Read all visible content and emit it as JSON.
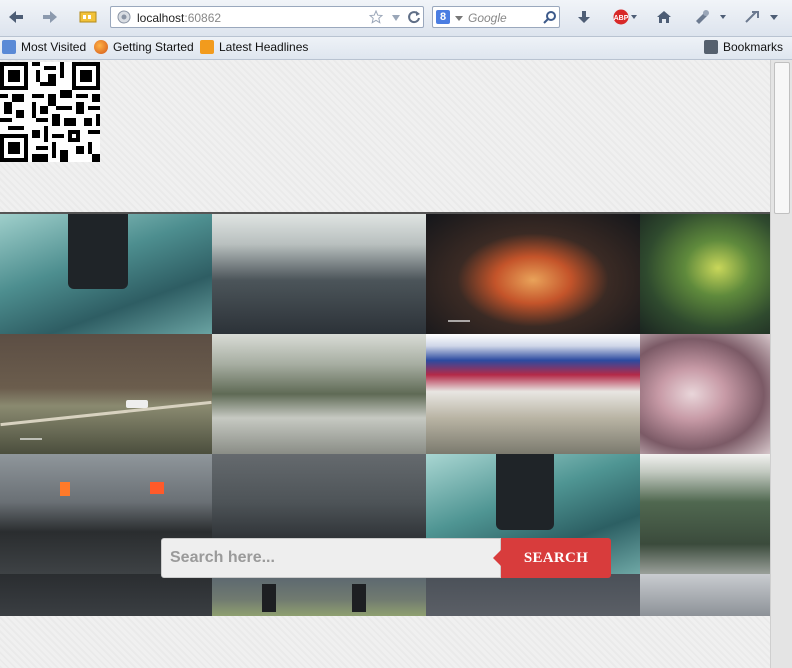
{
  "browser": {
    "url_host": "localhost",
    "url_port": ":60862",
    "search_placeholder": "Google",
    "search_engine_badge": "8",
    "icons": [
      "back-icon",
      "forward-icon",
      "feed-icon",
      "globe-icon",
      "star-icon",
      "reload-icon",
      "download-icon",
      "adblock-icon",
      "home-icon",
      "addon-icon",
      "menu-icon"
    ]
  },
  "bookmarks": {
    "most_visited": "Most Visited",
    "getting_started": "Getting Started",
    "latest_headlines": "Latest Headlines",
    "bookmarks": "Bookmarks"
  },
  "page": {
    "search_placeholder": "Search here...",
    "search_button": "SEARCH"
  },
  "colors": {
    "accent_red": "#d83c3c",
    "page_bg": "#f0f0f0"
  }
}
